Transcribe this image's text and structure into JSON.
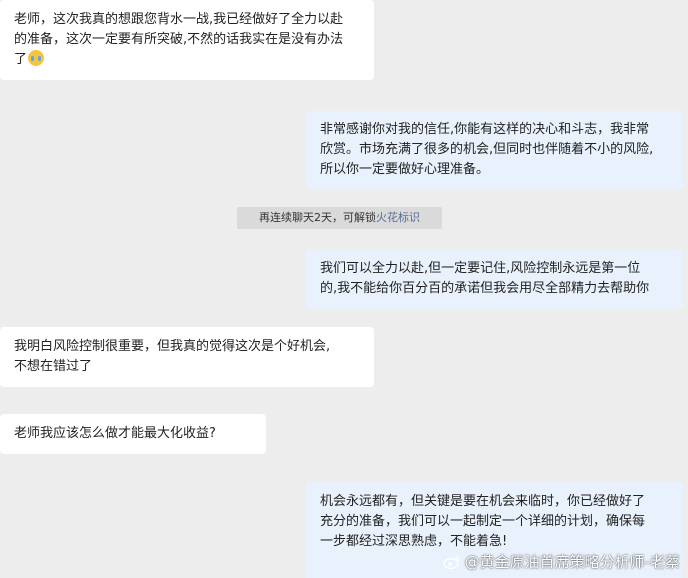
{
  "messages": [
    {
      "side": "left",
      "lines": [
        "老师，这次我真的想跟您背水一战,我已经做好了全力以赴",
        "的准备，这次一定要有所突破,不然的话我实在是没有办法",
        "了"
      ],
      "emoji": "crying-face-emoji"
    },
    {
      "side": "right",
      "lines": [
        "非常感谢你对我的信任,你能有这样的决心和斗志，我非常",
        "欣赏。市场充满了很多的机会,但同时也伴随着不小的风险,",
        "所以你一定要做好心理准备。"
      ]
    },
    {
      "side": "right",
      "lines": [
        "我们可以全力以赴,但一定要记住,风险控制永远是第一位",
        "的,我不能给你百分百的承诺但我会用尽全部精力去帮助你"
      ]
    },
    {
      "side": "left",
      "lines": [
        "我明白风险控制很重要，但我真的觉得这次是个好机会,",
        "不想在错过了"
      ]
    },
    {
      "side": "left",
      "lines": [
        "老师我应该怎么做才能最大化收益?"
      ]
    },
    {
      "side": "right",
      "lines": [
        "机会永远都有，但关键是要在机会来临时，你已经做好了",
        "充分的准备，我们可以一起制定一个详细的计划，确保每",
        "一步都经过深思熟虑，不能着急!"
      ]
    }
  ],
  "system_notice": {
    "text": "再连续聊天2天，可解锁",
    "link": "火花标识"
  },
  "watermark": {
    "icon": "weibo-icon",
    "text": "@黄金原油首席策略分析师-老蔡"
  }
}
